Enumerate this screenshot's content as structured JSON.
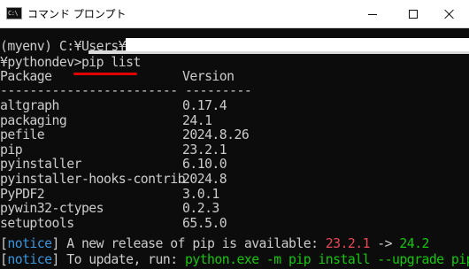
{
  "window": {
    "title": "コマンド プロンプト",
    "icon_text": "C:\\"
  },
  "console": {
    "prompt_line_1": "(myenv) C:¥Users¥",
    "prompt_line_2": "¥pythondev>",
    "command": "pip list",
    "header_package": "Package",
    "header_version": "Version",
    "separator": "------------------------ ---------",
    "packages": [
      {
        "name": "altgraph",
        "version": "0.17.4"
      },
      {
        "name": "packaging",
        "version": "24.1"
      },
      {
        "name": "pefile",
        "version": "2024.8.26"
      },
      {
        "name": "pip",
        "version": "23.2.1"
      },
      {
        "name": "pyinstaller",
        "version": "6.10.0"
      },
      {
        "name": "pyinstaller-hooks-contrib",
        "version": "2024.8"
      },
      {
        "name": "PyPDF2",
        "version": "3.0.1"
      },
      {
        "name": "pywin32-ctypes",
        "version": "0.2.3"
      },
      {
        "name": "setuptools",
        "version": "65.5.0"
      }
    ],
    "notice_tag": "notice",
    "notice_1_text": " A new release of pip is available: ",
    "notice_1_old": "23.2.1",
    "notice_1_arrow": " -> ",
    "notice_1_new": "24.2",
    "notice_2_text": " To update, run: ",
    "notice_2_cmd": "python.exe -m pip install --upgrade pip"
  },
  "colors": {
    "background": "#0c0c0c",
    "text": "#cccccc",
    "notice": "#3a96dd",
    "old_version": "#e74856",
    "new_version": "#16c60c",
    "annotation_underline": "#e10000"
  }
}
